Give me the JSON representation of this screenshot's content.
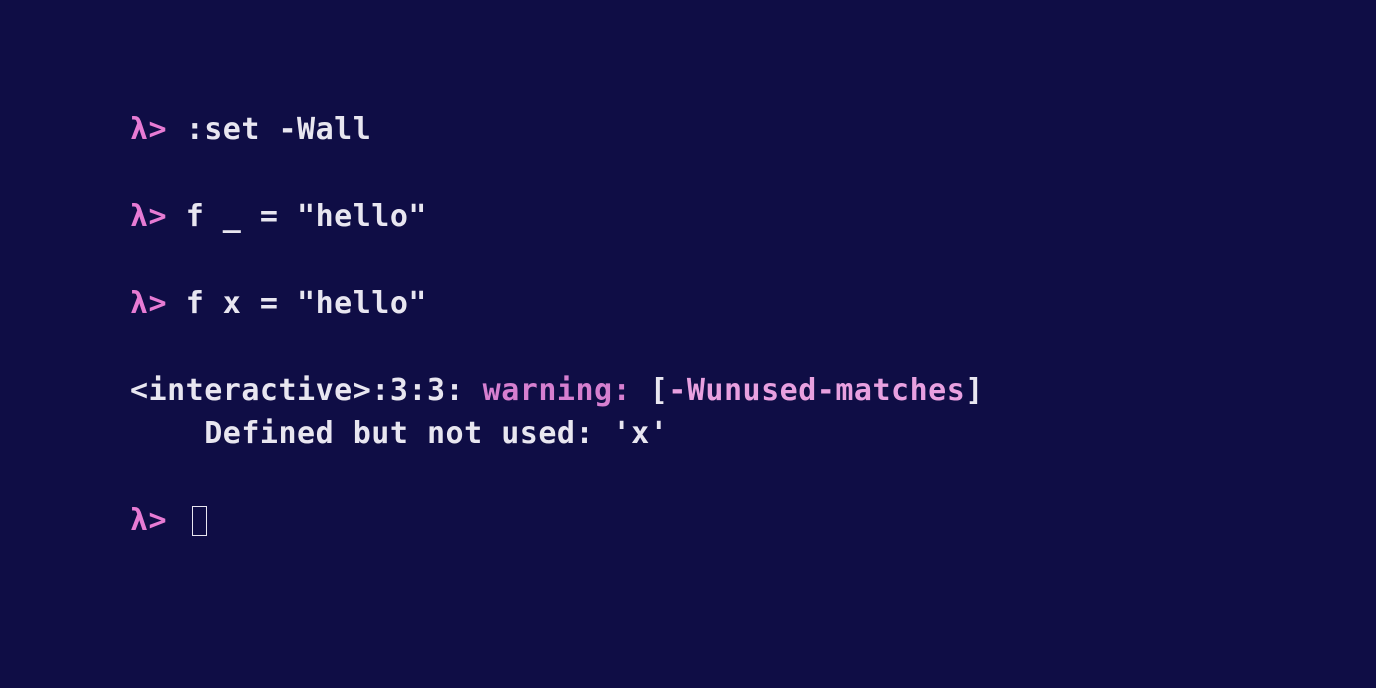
{
  "terminal": {
    "prompt": "λ>",
    "lines": [
      {
        "cmd": ":set -Wall"
      },
      {
        "cmd": "f _ = \"hello\""
      },
      {
        "cmd": "f x = \"hello\""
      }
    ],
    "warning": {
      "location": "<interactive>:3:3:",
      "label": "warning:",
      "bracket_open": "[",
      "flag": "-Wunused-matches",
      "bracket_close": "]",
      "detail": "    Defined but not used: 'x'"
    }
  }
}
